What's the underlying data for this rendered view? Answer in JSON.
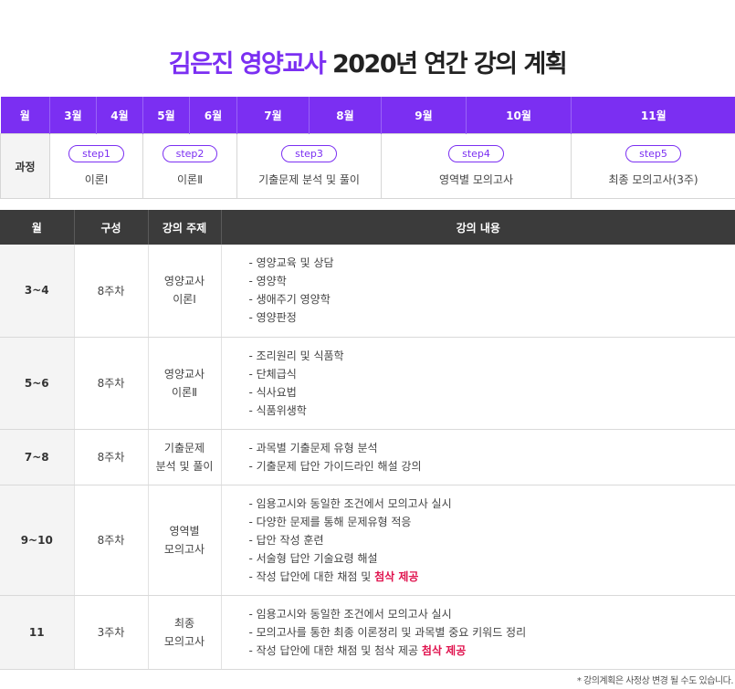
{
  "title": {
    "accent": "김은진 영양교사",
    "rest": " 2020년 연간 강의 계획"
  },
  "schedule": {
    "header": [
      "월",
      "3월",
      "4월",
      "5월",
      "6월",
      "7월",
      "8월",
      "9월",
      "10월",
      "11월"
    ],
    "row_label": "과정",
    "steps": [
      {
        "step": "step1",
        "course": "이론Ⅰ"
      },
      {
        "step": "step2",
        "course": "이론Ⅱ"
      },
      {
        "step": "step3",
        "course": "기출문제 분석 및 풀이"
      },
      {
        "step": "step4",
        "course": "영역별 모의고사"
      },
      {
        "step": "step5",
        "course": "최종 모의고사(3주)"
      }
    ]
  },
  "plan": {
    "headers": [
      "월",
      "구성",
      "강의 주제",
      "강의 내용"
    ],
    "rows": [
      {
        "month": "3~4",
        "weeks": "8주차",
        "topic": [
          "영양교사",
          "이론Ⅰ"
        ],
        "items": [
          "- 영양교육 및 상담",
          "- 영양학",
          "- 생애주기 영양학",
          "- 영양판정"
        ]
      },
      {
        "month": "5~6",
        "weeks": "8주차",
        "topic": [
          "영양교사",
          "이론Ⅱ"
        ],
        "items": [
          "- 조리원리 및 식품학",
          "- 단체급식",
          "- 식사요법",
          "- 식품위생학"
        ]
      },
      {
        "month": "7~8",
        "weeks": "8주차",
        "topic": [
          "기출문제",
          "분석 및 풀이"
        ],
        "items": [
          "- 과목별 기출문제 유형 분석",
          "- 기출문제 답안 가이드라인 해설 강의"
        ]
      },
      {
        "month": "9~10",
        "weeks": "8주차",
        "topic": [
          "영역별",
          "모의고사"
        ],
        "items": [
          "- 임용고시와 동일한 조건에서 모의고사 실시",
          "- 다양한 문제를 통해 문제유형 적응",
          "- 답안 작성 훈련",
          "- 서술형 답안 기술요령 해설",
          "- 작성 답안에 대한 채점 및 "
        ],
        "highlight": "첨삭 제공"
      },
      {
        "month": "11",
        "weeks": "3주차",
        "topic": [
          "최종",
          "모의고사"
        ],
        "items": [
          "- 임용고시와 동일한 조건에서 모의고사 실시",
          "- 모의고사를 통한 최종 이론정리 및 과목별 중요 키워드 정리",
          "- 작성 답안에 대한 채점 및 첨삭 제공 "
        ],
        "highlight": "첨삭 제공"
      }
    ]
  },
  "note": "* 강의계획은 사정상 변경 될 수도 있습니다."
}
